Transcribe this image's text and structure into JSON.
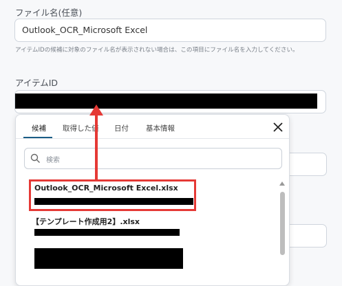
{
  "file_name": {
    "label": "ファイル名(任意)",
    "value": "Outlook_OCR_Microsoft Excel",
    "help": "アイテムIDの候補に対象のファイル名が表示されない場合は、この項目にファイル名を入力してください。"
  },
  "item_id": {
    "label": "アイテムID"
  },
  "popup": {
    "tabs": [
      {
        "label": "候補",
        "active": true
      },
      {
        "label": "取得した値",
        "active": false
      },
      {
        "label": "日付",
        "active": false
      },
      {
        "label": "基本情報",
        "active": false
      }
    ],
    "search_placeholder": "検索",
    "items": [
      {
        "title": "Outlook_OCR_Microsoft Excel.xlsx"
      },
      {
        "title": "【テンプレート作成用2】.xlsx"
      }
    ]
  },
  "colors": {
    "accent": "#1a5c86",
    "highlight": "#e53935",
    "redaction": "#000000"
  },
  "icons": [
    "close-icon",
    "search-icon",
    "scroll-up-icon"
  ]
}
